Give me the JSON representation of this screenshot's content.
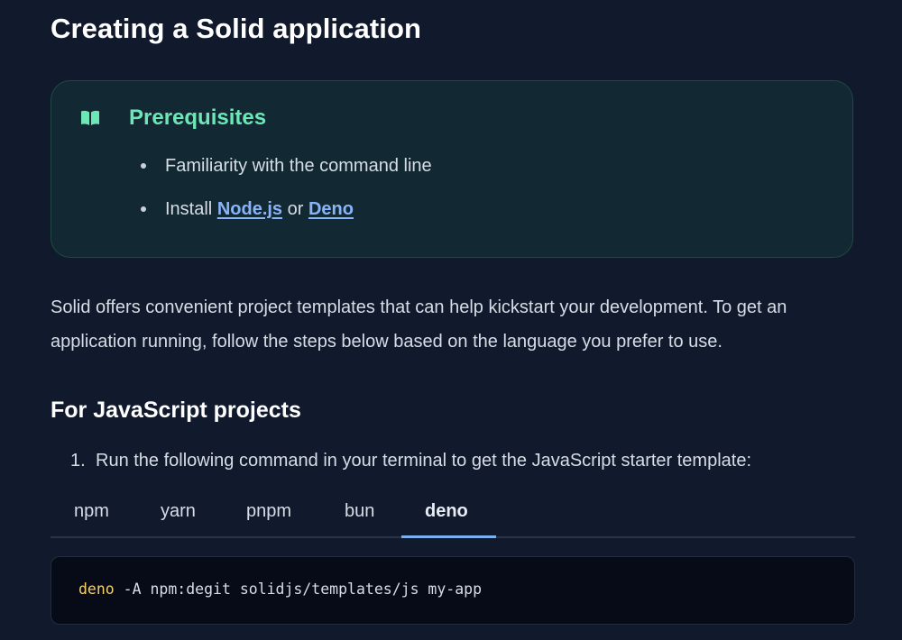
{
  "page": {
    "title": "Creating a Solid application"
  },
  "prerequisites": {
    "heading": "Prerequisites",
    "icon": "book-open-icon",
    "items": [
      {
        "text": "Familiarity with the command line"
      },
      {
        "prefix": "Install ",
        "link1": "Node.js",
        "middle": " or ",
        "link2": "Deno"
      }
    ]
  },
  "intro": {
    "text": "Solid offers convenient project templates that can help kickstart your development. To get an application running, follow the steps below based on the language you prefer to use."
  },
  "section": {
    "heading": "For JavaScript projects",
    "step_number": "1.",
    "step_text": "Run the following command in your terminal to get the JavaScript starter template:"
  },
  "tabs": {
    "items": [
      "npm",
      "yarn",
      "pnpm",
      "bun",
      "deno"
    ],
    "active": "deno"
  },
  "code": {
    "command": "deno",
    "args": " -A npm:degit solidjs/templates/js my-app"
  },
  "colors": {
    "background": "#111a2c",
    "callout_bg": "#122833",
    "callout_accent": "#6ee7b7",
    "link": "#8ab4f8",
    "tab_active_underline": "#7ab0ee",
    "code_command": "#f4d06f"
  }
}
